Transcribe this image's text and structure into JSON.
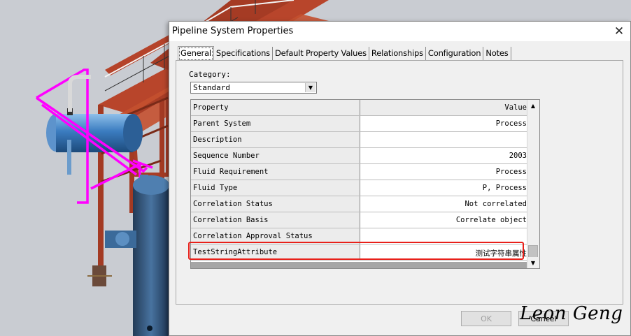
{
  "dialog": {
    "title": "Pipeline System Properties",
    "close_icon": "close-icon"
  },
  "tabs": [
    {
      "label": "General",
      "active": true
    },
    {
      "label": "Specifications",
      "active": false
    },
    {
      "label": "Default Property Values",
      "active": false
    },
    {
      "label": "Relationships",
      "active": false
    },
    {
      "label": "Configuration",
      "active": false
    },
    {
      "label": "Notes",
      "active": false
    }
  ],
  "category": {
    "label": "Category:",
    "value": "Standard"
  },
  "grid": {
    "header": {
      "property": "Property",
      "value": "Value"
    },
    "rows": [
      {
        "property": "Parent System",
        "value": "Process"
      },
      {
        "property": "Description",
        "value": ""
      },
      {
        "property": "Sequence Number",
        "value": "2003"
      },
      {
        "property": "Fluid Requirement",
        "value": "Process"
      },
      {
        "property": "Fluid Type",
        "value": "P, Process"
      },
      {
        "property": "Correlation Status",
        "value": "Not correlated"
      },
      {
        "property": "Correlation Basis",
        "value": "Correlate object"
      },
      {
        "property": "Correlation Approval Status",
        "value": ""
      },
      {
        "property": "TestStringAttribute",
        "value": "测试字符串属性"
      }
    ]
  },
  "buttons": {
    "ok": "OK",
    "cancel": "Cancel"
  },
  "watermark": "Leon Geng",
  "colors": {
    "highlight": "#e8201a",
    "pipe_magenta": "#ff00ff",
    "steel_red": "#b5432a",
    "vessel_blue": "#2f6aa8"
  }
}
